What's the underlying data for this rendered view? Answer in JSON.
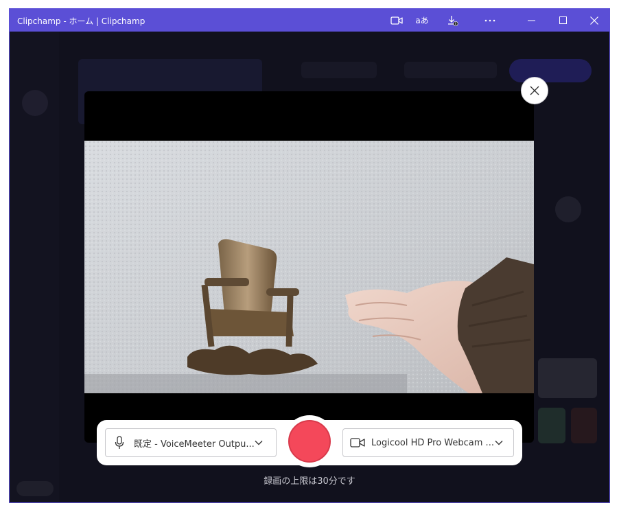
{
  "window": {
    "title": "Clipchamp - ホーム | Clipchamp",
    "translate_label": "aあ"
  },
  "recorder": {
    "microphone": {
      "icon": "microphone-icon",
      "selected": "既定 - VoiceMeeter Outpu..."
    },
    "camera": {
      "icon": "video-camera-icon",
      "selected": "Logicool HD Pro Webcam ..."
    },
    "limit_note": "録画の上限は30分です"
  },
  "colors": {
    "titlebar": "#5b4fd6",
    "record": "#f4485a",
    "background": "#1c1b29"
  }
}
